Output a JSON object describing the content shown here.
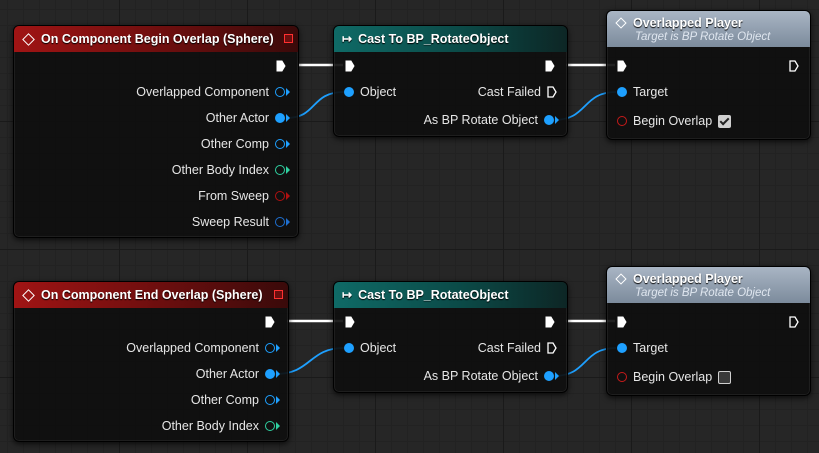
{
  "graph1": {
    "event": {
      "title": "On Component Begin Overlap (Sphere)",
      "pins": [
        "Overlapped Component",
        "Other Actor",
        "Other Comp",
        "Other Body Index",
        "From Sweep",
        "Sweep Result"
      ]
    },
    "cast": {
      "title": "Cast To BP_RotateObject",
      "object": "Object",
      "failed": "Cast Failed",
      "as": "As BP Rotate Object"
    },
    "func": {
      "title": "Overlapped Player",
      "subtitle": "Target is BP Rotate Object",
      "target": "Target",
      "param": "Begin Overlap",
      "checked": true
    }
  },
  "graph2": {
    "event": {
      "title": "On Component End Overlap (Sphere)",
      "pins": [
        "Overlapped Component",
        "Other Actor",
        "Other Comp",
        "Other Body Index"
      ]
    },
    "cast": {
      "title": "Cast To BP_RotateObject",
      "object": "Object",
      "failed": "Cast Failed",
      "as": "As BP Rotate Object"
    },
    "func": {
      "title": "Overlapped Player",
      "subtitle": "Target is BP Rotate Object",
      "target": "Target",
      "param": "Begin Overlap",
      "checked": false
    }
  },
  "colors": {
    "event_header": "#a01414",
    "cast_header": "#0f6a66",
    "func_header": "#9aa7b6",
    "object_pin": "#1ea0ff",
    "int_pin": "#2fd0a0",
    "bool_pin": "#b01010",
    "exec_wire": "#ffffff"
  }
}
